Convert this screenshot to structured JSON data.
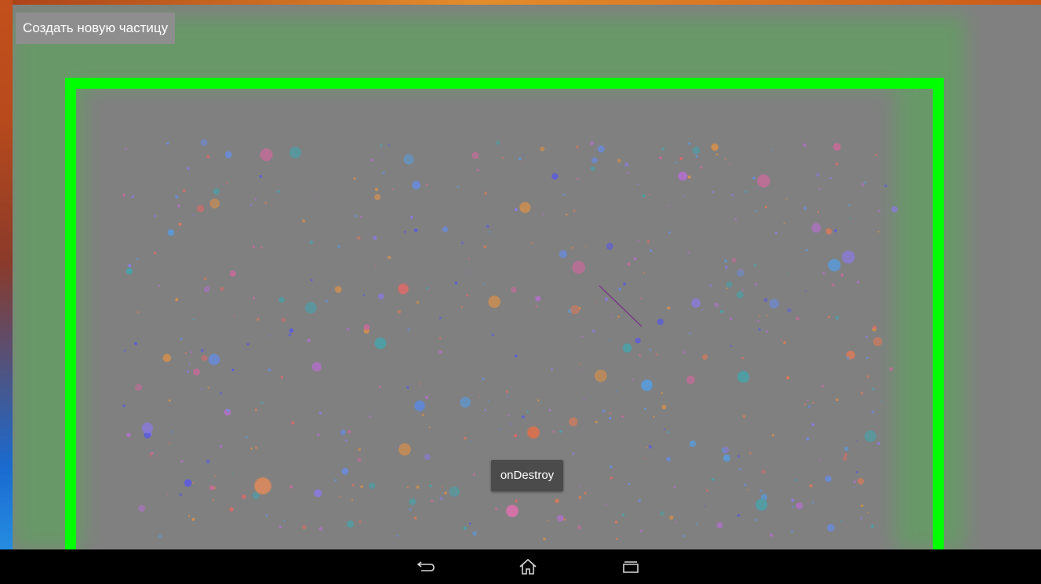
{
  "app": {
    "create_button_label": "Создать новую частицу"
  },
  "toast": {
    "text": "onDestroy"
  },
  "colors": {
    "screen_background": "#808080",
    "frame_green": "#00ff00",
    "glow_green": "#64a064",
    "navbar": "#000000"
  },
  "navbar": {
    "buttons": [
      "back-icon",
      "home-icon",
      "recent-apps-icon"
    ]
  }
}
